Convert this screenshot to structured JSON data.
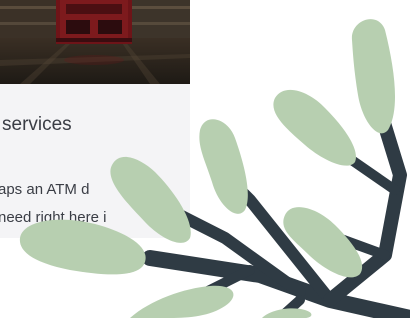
{
  "card": {
    "title": "services",
    "text_line_1": "aps an ATM    d",
    "text_line_2": "need right here i"
  },
  "colors": {
    "leaf": "#b7cfb0",
    "branch": "#2f3b44",
    "card_bg": "#f4f4f6",
    "text": "#3a3d45",
    "door_red": "#6e1418"
  },
  "icons": {
    "decoration": "leafy-branch-icon",
    "photo": "red-door-photo"
  }
}
